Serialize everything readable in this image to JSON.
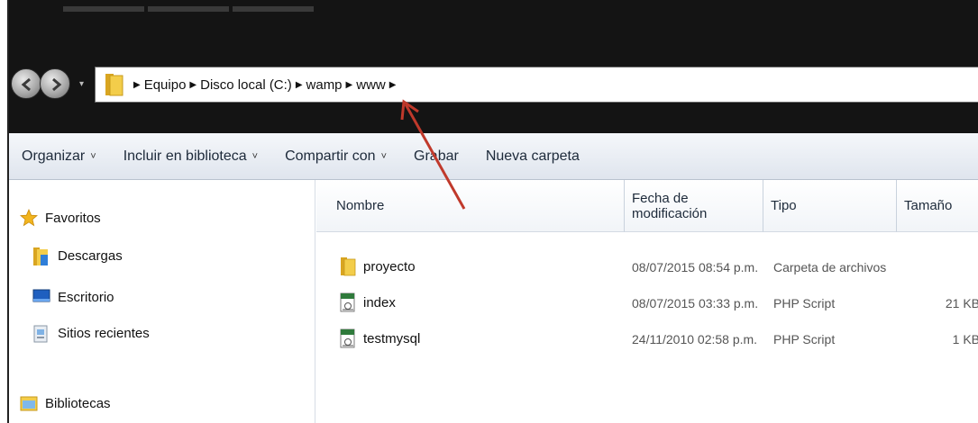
{
  "address": {
    "crumbs": [
      "Equipo",
      "Disco local (C:)",
      "wamp",
      "www"
    ]
  },
  "toolbar": {
    "organize": "Organizar",
    "include": "Incluir en biblioteca",
    "share": "Compartir con",
    "burn": "Grabar",
    "new_folder": "Nueva carpeta"
  },
  "sidebar": {
    "favorites": "Favoritos",
    "items": [
      "Descargas",
      "Escritorio",
      "Sitios recientes"
    ],
    "libraries": "Bibliotecas"
  },
  "columns": {
    "name": "Nombre",
    "date": "Fecha de modificación",
    "type": "Tipo",
    "size": "Tamaño"
  },
  "files": [
    {
      "name": "proyecto",
      "date": "08/07/2015 08:54 p.m.",
      "type": "Carpeta de archivos",
      "size": "",
      "icon": "folder-icon"
    },
    {
      "name": "index",
      "date": "08/07/2015 03:33 p.m.",
      "type": "PHP Script",
      "size": "21 KB",
      "icon": "php-file-icon"
    },
    {
      "name": "testmysql",
      "date": "24/11/2010 02:58 p.m.",
      "type": "PHP Script",
      "size": "1 KB",
      "icon": "php-file-icon"
    }
  ],
  "colors": {
    "annotation_arrow": "#c0392b",
    "titlebar": "#141414"
  }
}
